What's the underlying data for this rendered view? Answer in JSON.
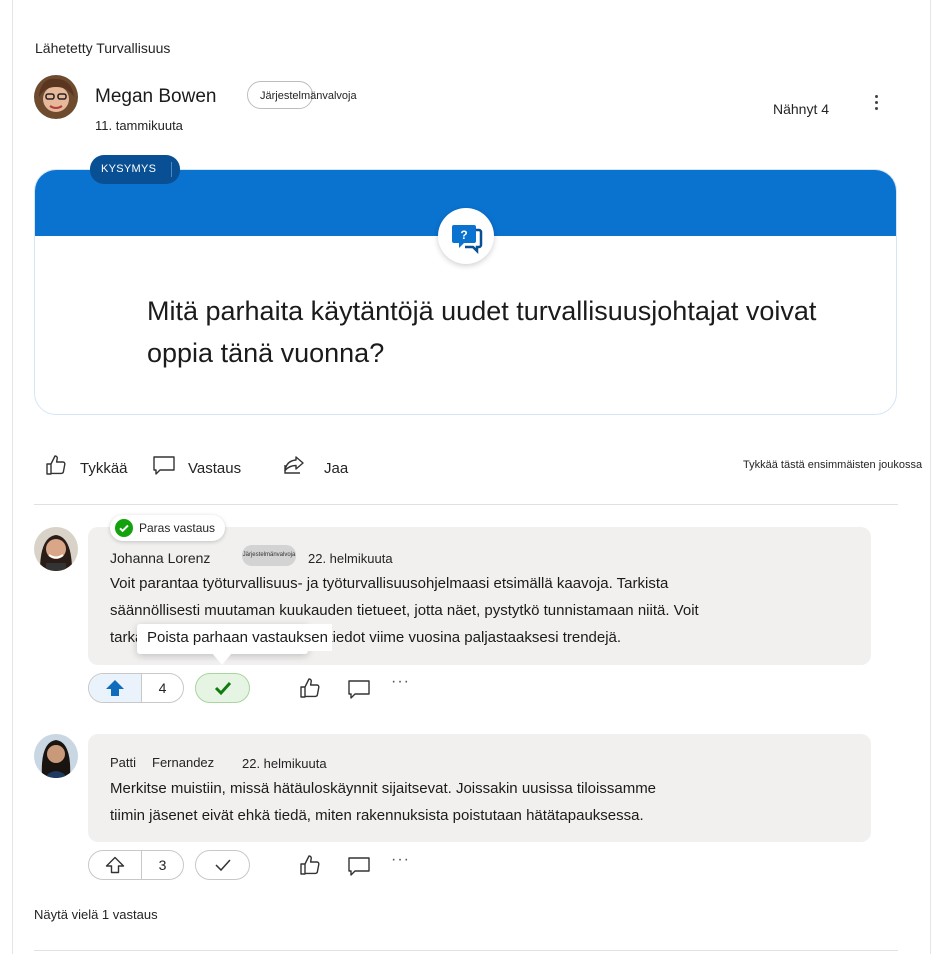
{
  "post": {
    "sent_in": "Lähetetty Turvallisuus",
    "author": "Megan Bowen",
    "role": "Järjestelmänvalvoja",
    "date": "11. tammikuuta",
    "seen": "Nähnyt 4",
    "type_label": "KYSYMYS",
    "question": "Mitä parhaita käytäntöjä uudet turvallisuusjohtajat voivat oppia tänä vuonna?"
  },
  "actions": {
    "like": "Tykkää",
    "reply": "Vastaus",
    "share": "Jaa",
    "like_prompt": "Tykkää tästä ensimmäisten joukossa"
  },
  "replies": [
    {
      "best_label": "Paras vastaus",
      "name": "Johanna Lorenz",
      "role": "Järjestelmänvalvoja",
      "date": "22. helmikuuta",
      "line1": "Voit parantaa työturvallisuus- ja työturvallisuusohjelmaasi etsimällä kaavoja. Tarkista",
      "line2": "säännöllisesti muutaman kuukauden tietueet, jotta näet, pystytkö tunnistamaan niitä. Voit",
      "line3": "tarkastella esimerkiksi tapaturmatiedot viime vuosina paljastaaksesi trendejä.",
      "votes": "4",
      "tooltip": "Poista parhaan vastauksen"
    },
    {
      "first_name": "Patti",
      "last_name": "Fernandez",
      "date": "22. helmikuuta",
      "line1": "Merkitse muistiin, missä hätäuloskäynnit sijaitsevat. Joissakin uusissa tiloissamme",
      "line2": "tiimin jäsenet eivät ehkä tiedä, miten rakennuksista poistutaan hätätapauksessa.",
      "votes": "3"
    }
  ],
  "show_more": "Näytä vielä 1 vastaus",
  "colors": {
    "accent": "#0a72cf",
    "dark_accent": "#094f94",
    "best_green": "#13a10e",
    "bubble": "#f1f0ef"
  },
  "icons": [
    "kebab-icon",
    "question-bubble-icon",
    "thumbs-up-icon",
    "comment-icon",
    "share-icon",
    "check-circle-icon",
    "upvote-arrow-icon",
    "checkmark-icon",
    "more-horizontal-icon"
  ]
}
